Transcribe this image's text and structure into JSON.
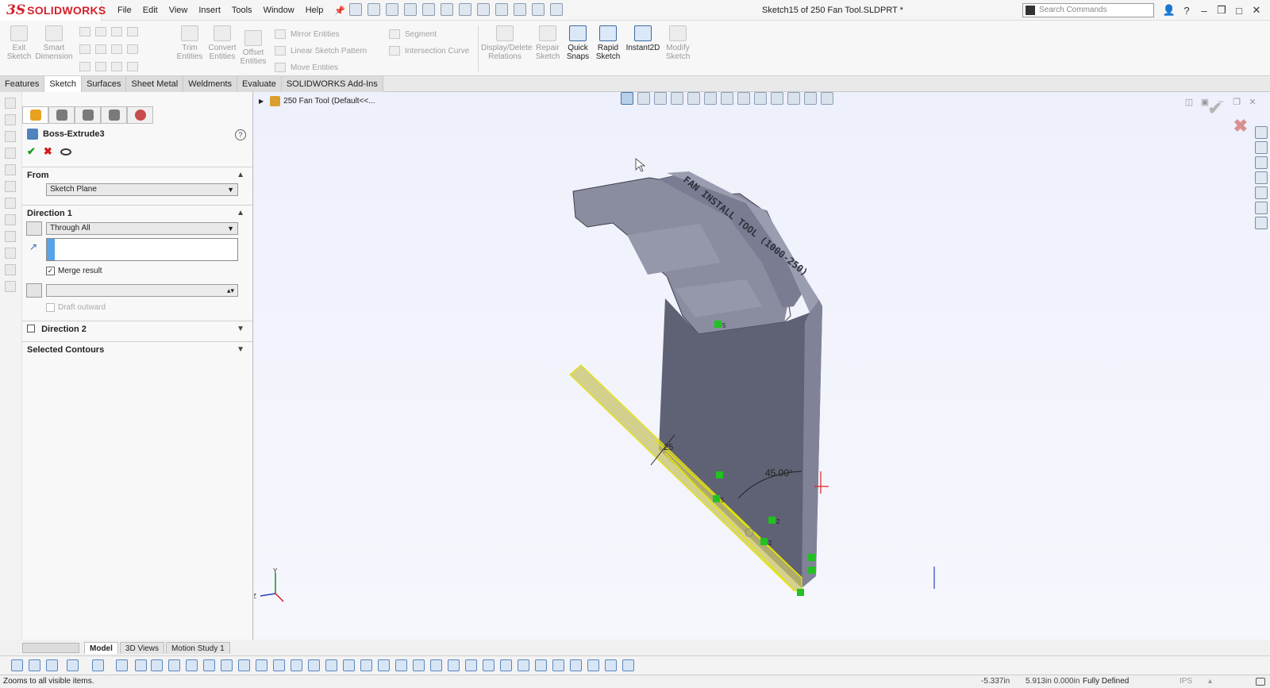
{
  "app": {
    "logo_prefix": "3S",
    "logo_name": "SOLIDWORKS",
    "document_title": "Sketch15 of 250 Fan Tool.SLDPRT *"
  },
  "menu": [
    "File",
    "Edit",
    "View",
    "Insert",
    "Tools",
    "Window",
    "Help"
  ],
  "search": {
    "placeholder": "Search Commands"
  },
  "command_manager": {
    "exit_sketch": "Exit Sketch",
    "smart_dimension": "Smart Dimension",
    "trim_entities": "Trim Entities",
    "convert_entities": "Convert Entities",
    "offset_entities": "Offset Entities",
    "mirror_entities": "Mirror Entities",
    "linear_sketch_pattern": "Linear Sketch Pattern",
    "move_entities": "Move Entities",
    "segment": "Segment",
    "intersection_curve": "Intersection Curve",
    "display_delete_relations": "Display/Delete Relations",
    "repair_sketch": "Repair Sketch",
    "quick_snaps": "Quick Snaps",
    "rapid_sketch": "Rapid Sketch",
    "instant2d": "Instant2D",
    "modify_sketch": "Modify Sketch"
  },
  "tabs": [
    "Features",
    "Sketch",
    "Surfaces",
    "Sheet Metal",
    "Weldments",
    "Evaluate",
    "SOLIDWORKS Add-Ins"
  ],
  "active_tab": "Sketch",
  "property_manager": {
    "feature_name": "Boss-Extrude3",
    "from_label": "From",
    "from_value": "Sketch Plane",
    "direction1_label": "Direction 1",
    "direction1_type": "Through All",
    "merge_result": "Merge result",
    "draft_outward": "Draft outward",
    "direction2_label": "Direction 2",
    "selected_contours_label": "Selected Contours"
  },
  "viewport": {
    "tree_path": "250 Fan Tool (Default<<...",
    "engraving": "FAN INSTALL TOOL (1000-250)",
    "dim_25": "25",
    "dim_angle": "45.00°",
    "relation_5a": "5",
    "relation_5b": "5",
    "relation_2a": "2",
    "relation_2b": "2",
    "axis_y": "Y",
    "axis_z": "Z"
  },
  "bottom_tabs": [
    "Model",
    "3D Views",
    "Motion Study 1"
  ],
  "active_bottom_tab": "Model",
  "status": {
    "message": "Zooms to all visible items.",
    "x_coord": "-5.337in",
    "yz_coords": "5.913in 0.000in",
    "sketch_state": "Fully Defined",
    "units": "IPS"
  },
  "colors": {
    "brand_red": "#d4202a",
    "ok_green": "#1c9a1c",
    "cancel_red": "#d21b1b",
    "sketch_yellow": "#e6e600",
    "relation_green": "#22c022",
    "model_gray": "#6b6e80"
  }
}
